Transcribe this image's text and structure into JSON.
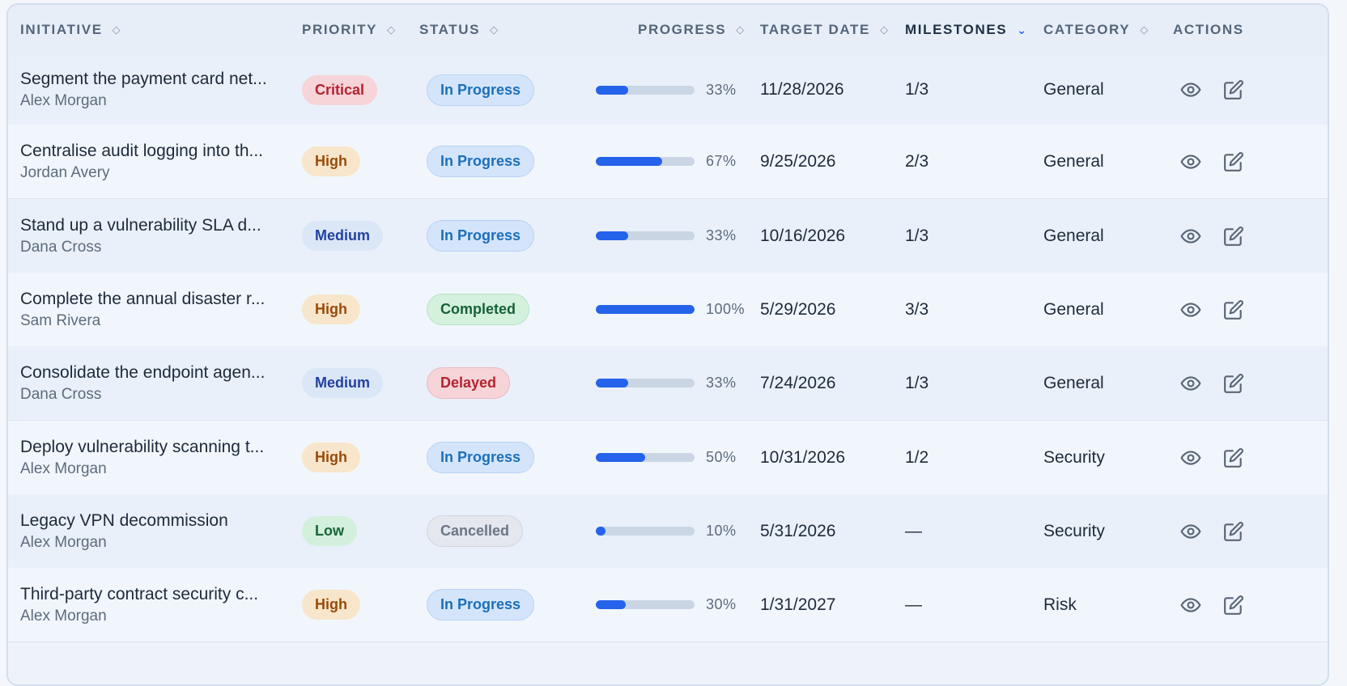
{
  "headers": {
    "initiative": "INITIATIVE",
    "priority": "PRIORITY",
    "status": "STATUS",
    "progress": "PROGRESS",
    "target_date": "TARGET DATE",
    "milestones": "MILESTONES",
    "category": "CATEGORY",
    "actions": "ACTIONS"
  },
  "sort": {
    "active_column": "milestones",
    "direction": "descending"
  },
  "priority_colors": {
    "Critical": {
      "bg": "#f6d4d8",
      "fg": "#b3232f"
    },
    "High": {
      "bg": "#f7e6cb",
      "fg": "#9a4a0b"
    },
    "Medium": {
      "bg": "#dbe6f7",
      "fg": "#2242a0"
    },
    "Low": {
      "bg": "#d3f0dd",
      "fg": "#16663a"
    }
  },
  "status_colors": {
    "In Progress": {
      "bg": "#d4e5fb",
      "fg": "#1d6fb8",
      "border": "#b8d2f4"
    },
    "Completed": {
      "bg": "#d4f1dd",
      "fg": "#16613a",
      "border": "#b5e3c4"
    },
    "Delayed": {
      "bg": "#f6d4d8",
      "fg": "#b3232f",
      "border": "#ebb8bf"
    },
    "Cancelled": {
      "bg": "#e4e8ee",
      "fg": "#6b7687",
      "border": "#cfd6e0"
    }
  },
  "rows": [
    {
      "title": "Segment the payment card net...",
      "owner": "Alex Morgan",
      "priority": "Critical",
      "status": "In Progress",
      "progress": 33,
      "progress_label": "33%",
      "target_date": "11/28/2026",
      "milestones": "1/3",
      "category": "General"
    },
    {
      "title": "Centralise audit logging into th...",
      "owner": "Jordan Avery",
      "priority": "High",
      "status": "In Progress",
      "progress": 67,
      "progress_label": "67%",
      "target_date": "9/25/2026",
      "milestones": "2/3",
      "category": "General"
    },
    {
      "title": "Stand up a vulnerability SLA d...",
      "owner": "Dana Cross",
      "priority": "Medium",
      "status": "In Progress",
      "progress": 33,
      "progress_label": "33%",
      "target_date": "10/16/2026",
      "milestones": "1/3",
      "category": "General"
    },
    {
      "title": "Complete the annual disaster r...",
      "owner": "Sam Rivera",
      "priority": "High",
      "status": "Completed",
      "progress": 100,
      "progress_label": "100%",
      "target_date": "5/29/2026",
      "milestones": "3/3",
      "category": "General"
    },
    {
      "title": "Consolidate the endpoint agen...",
      "owner": "Dana Cross",
      "priority": "Medium",
      "status": "Delayed",
      "progress": 33,
      "progress_label": "33%",
      "target_date": "7/24/2026",
      "milestones": "1/3",
      "category": "General"
    },
    {
      "title": "Deploy vulnerability scanning t...",
      "owner": "Alex Morgan",
      "priority": "High",
      "status": "In Progress",
      "progress": 50,
      "progress_label": "50%",
      "target_date": "10/31/2026",
      "milestones": "1/2",
      "category": "Security"
    },
    {
      "title": "Legacy VPN decommission",
      "owner": "Alex Morgan",
      "priority": "Low",
      "status": "Cancelled",
      "progress": 10,
      "progress_label": "10%",
      "target_date": "5/31/2026",
      "milestones": "—",
      "category": "Security"
    },
    {
      "title": "Third-party contract security c...",
      "owner": "Alex Morgan",
      "priority": "High",
      "status": "In Progress",
      "progress": 30,
      "progress_label": "30%",
      "target_date": "1/31/2027",
      "milestones": "—",
      "category": "Risk"
    }
  ],
  "icons": {
    "view": "eye-icon",
    "edit": "edit-icon",
    "sort": "sort-icon",
    "sort_active": "chevron-down-icon"
  }
}
